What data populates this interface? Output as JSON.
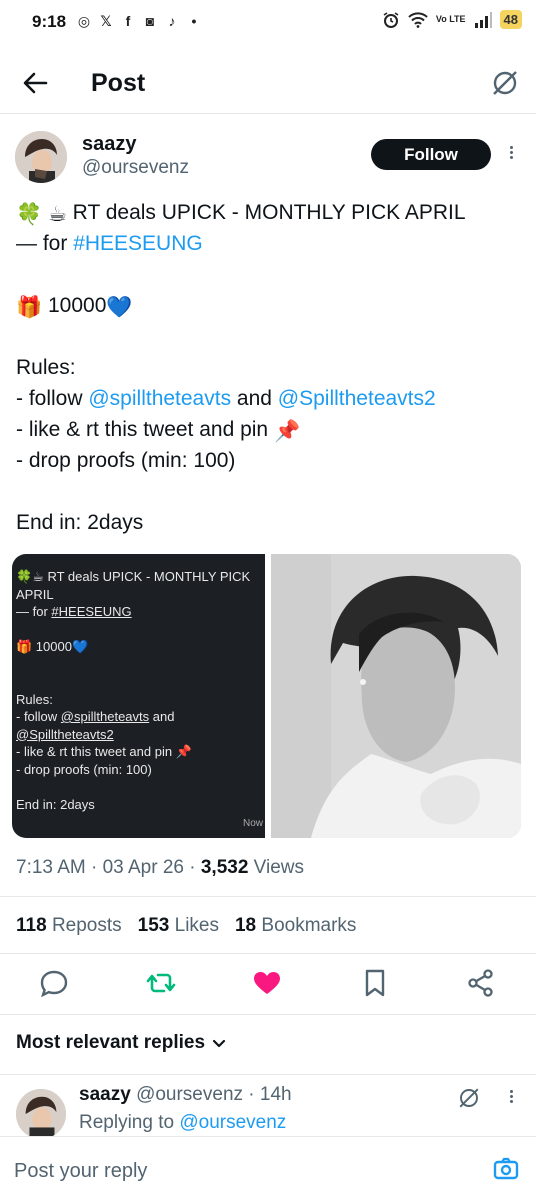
{
  "status_bar": {
    "time": "9:18",
    "notification_icons": [
      "whatsapp-icon",
      "x-icon",
      "facebook-icon",
      "instagram-icon",
      "tiktok-icon",
      "dot-icon"
    ],
    "network": "Vo LTE",
    "battery": "48"
  },
  "header": {
    "title": "Post"
  },
  "author": {
    "name": "saazy",
    "handle": "@oursevenz",
    "follow_label": "Follow"
  },
  "post": {
    "line1_text": " RT deals  UPICK - MONTHLY PICK APRIL",
    "line2_prefix": "— for ",
    "hashtag": "#HEESEUNG",
    "prize_amount": "10000",
    "rules_title": "Rules:",
    "rule1_prefix": "- follow ",
    "mention1": "@spilltheteavts",
    "rule1_and": " and ",
    "mention2": "@Spilltheteavts2",
    "rule2": "- like & rt this tweet and pin ",
    "rule3": "- drop proofs (min: 100)",
    "end": "End in: 2days"
  },
  "media_card": {
    "l1": " RT deals  UPICK - MONTHLY PICK",
    "l2": "APRIL",
    "l3_prefix": "— for ",
    "l3_tag": "#HEESEUNG",
    "l4": " 10000",
    "l5": "Rules:",
    "l6_prefix": "- follow ",
    "l6_mention": "@spilltheteavts",
    "l6_suffix": " and",
    "l7": "@Spilltheteavts2",
    "l8": "- like & rt this tweet and pin ",
    "l9": "- drop proofs (min: 100)",
    "l10": "End in: 2days",
    "corner": "Now"
  },
  "meta": {
    "time": "7:13 AM",
    "date": "03 Apr 26",
    "views_count": "3,532",
    "views_label": "Views"
  },
  "stats": {
    "reposts_count": "118",
    "reposts_label": "Reposts",
    "likes_count": "153",
    "likes_label": "Likes",
    "bookmarks_count": "18",
    "bookmarks_label": "Bookmarks"
  },
  "replies": {
    "heading": "Most relevant replies"
  },
  "reply": {
    "name": "saazy",
    "handle_time": "@oursevenz · 14h",
    "replying_prefix": "Replying to ",
    "replying_to": "@oursevenz"
  },
  "composer": {
    "placeholder": "Post your reply"
  },
  "colors": {
    "link": "#1d9bf0",
    "repost": "#00ba7c",
    "like": "#f91880",
    "text": "#0f1419",
    "secondary": "#536471"
  }
}
